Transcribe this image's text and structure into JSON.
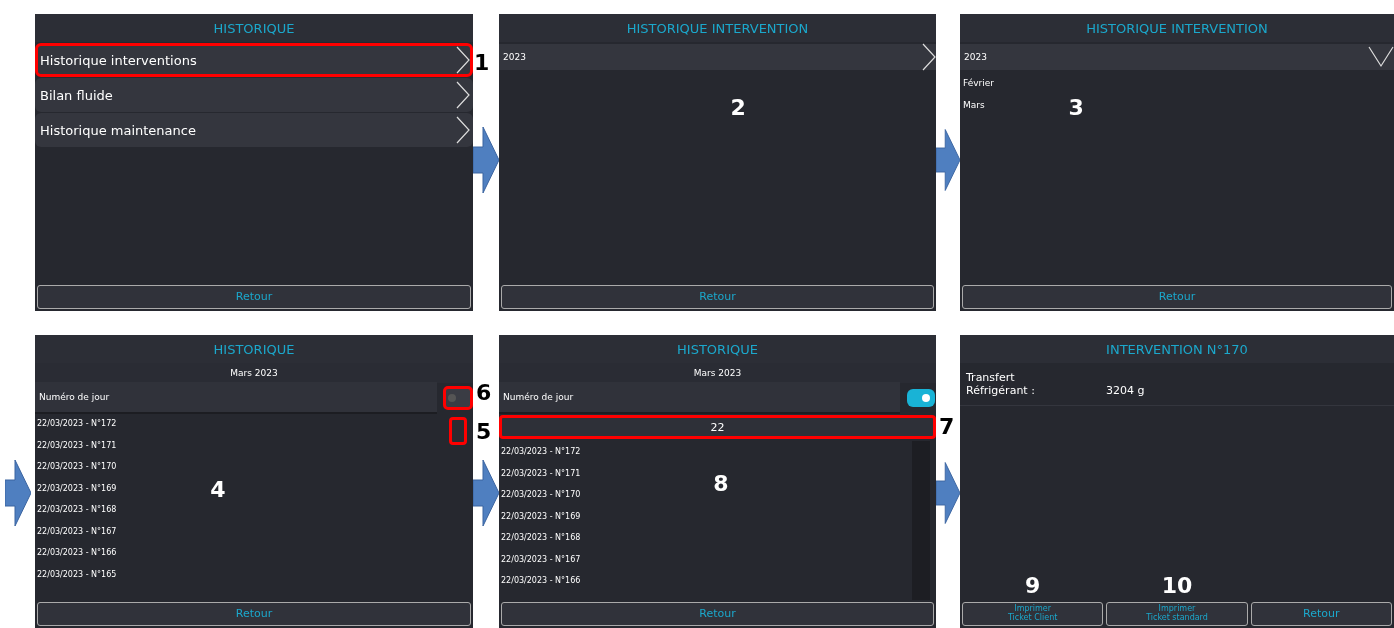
{
  "screens": [
    {
      "kind": "menu",
      "title": "HISTORIQUE",
      "items": [
        {
          "label": "Historique interventions",
          "highlighted": true,
          "callout": "1"
        },
        {
          "label": "Bilan fluide",
          "highlighted": false
        },
        {
          "label": "Historique maintenance",
          "highlighted": false
        }
      ],
      "buttons": [
        {
          "label": "Retour"
        }
      ]
    },
    {
      "kind": "accordion",
      "title": "HISTORIQUE INTERVENTION",
      "year": {
        "label": "2023",
        "expanded": false
      },
      "callout": "2",
      "buttons": [
        {
          "label": "Retour"
        }
      ]
    },
    {
      "kind": "accordion",
      "title": "HISTORIQUE INTERVENTION",
      "year": {
        "label": "2023",
        "expanded": true,
        "months": [
          "Février",
          "Mars"
        ]
      },
      "callout": "3",
      "buttons": [
        {
          "label": "Retour"
        }
      ]
    },
    {
      "kind": "day_list",
      "title": "HISTORIQUE",
      "subtitle": "Mars 2023",
      "filter": {
        "label": "Numéro de jour",
        "on": false,
        "highlighted": true,
        "callout": "6"
      },
      "scrollbar": {
        "highlighted": true,
        "callout": "5"
      },
      "entries": [
        "22/03/2023 - N°172",
        "22/03/2023 - N°171",
        "22/03/2023 - N°170",
        "22/03/2023 - N°169",
        "22/03/2023 - N°168",
        "22/03/2023 - N°167",
        "22/03/2023 - N°166",
        "22/03/2023 - N°165"
      ],
      "callout": "4",
      "buttons": [
        {
          "label": "Retour"
        }
      ]
    },
    {
      "kind": "day_list",
      "title": "HISTORIQUE",
      "subtitle": "Mars 2023",
      "filter": {
        "label": "Numéro de jour",
        "on": true,
        "highlighted": false
      },
      "day_field": {
        "value": "22",
        "highlighted": true,
        "callout": "7"
      },
      "scrollbar": {
        "highlighted": false
      },
      "entries": [
        "22/03/2023 - N°172",
        "22/03/2023 - N°171",
        "22/03/2023 - N°170",
        "22/03/2023 - N°169",
        "22/03/2023 - N°168",
        "22/03/2023 - N°167",
        "22/03/2023 - N°166"
      ],
      "callout": "8",
      "buttons": [
        {
          "label": "Retour"
        }
      ]
    },
    {
      "kind": "detail",
      "title": "INTERVENTION N°170",
      "fields": [
        {
          "label": "Transfert\nRéfrigérant :",
          "value": "3204 g"
        }
      ],
      "buttons": [
        {
          "label": "Imprimer\nTicket Client",
          "callout": "9"
        },
        {
          "label": "Imprimer\nTicket standard",
          "callout": "10"
        },
        {
          "label": "Retour"
        }
      ]
    }
  ]
}
